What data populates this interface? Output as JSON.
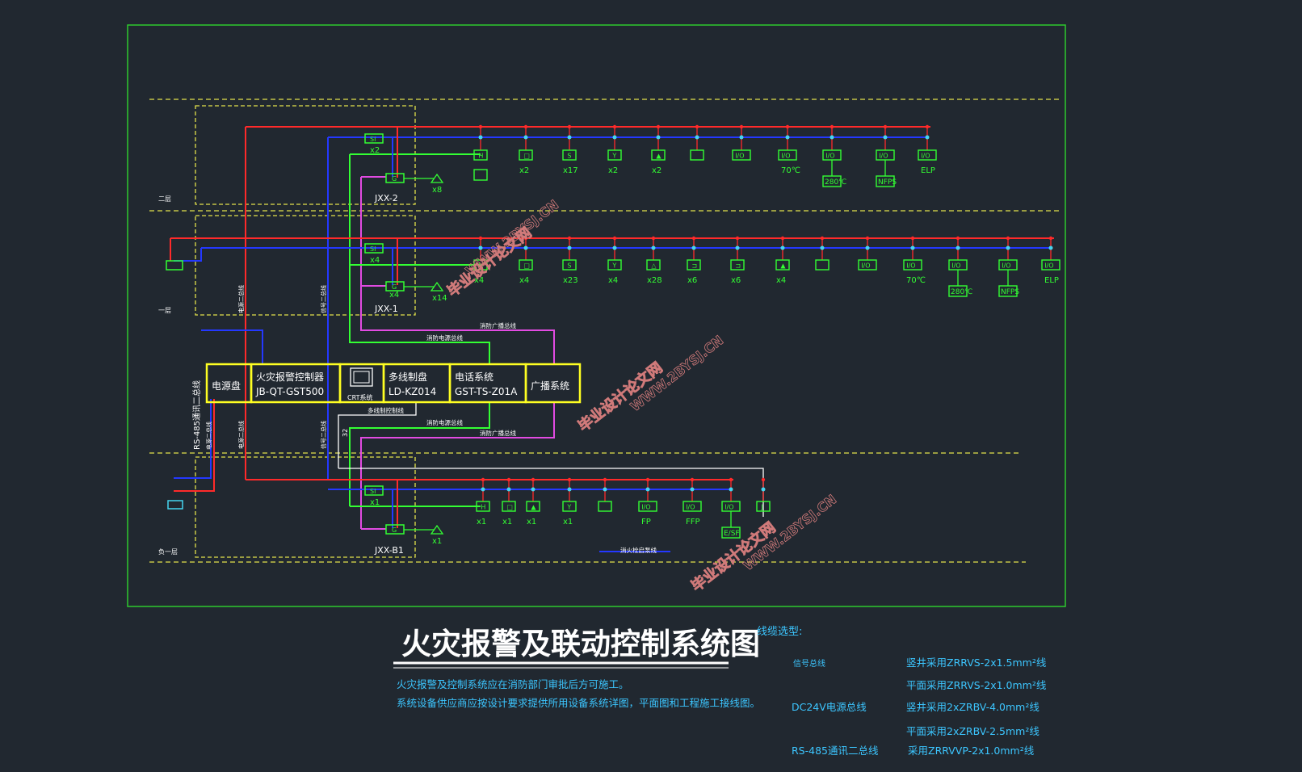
{
  "title": "火灾报警及联动控制系统图",
  "notes": [
    "火灾报警及控制系统应在消防部门审批后方可施工。",
    "系统设备供应商应按设计要求提供所用设备系统详图，平面图和工程施工接线图。"
  ],
  "cable": {
    "heading": "线缆选型:",
    "rows": [
      {
        "label": "信号总线",
        "value": "竖井采用ZRRVS-2x1.5mm²线"
      },
      {
        "label": "",
        "value": "平面采用ZRRVS-2x1.0mm²线"
      },
      {
        "label": "DC24V电源总线",
        "value": "竖井采用2xZRBV-4.0mm²线"
      },
      {
        "label": "",
        "value": "平面采用2xZRBV-2.5mm²线"
      },
      {
        "label": "RS-485通讯二总线",
        "value": "采用ZRRVVP-2x1.0mm²线"
      }
    ]
  },
  "floors": [
    "二层",
    "一层",
    "负一层"
  ],
  "boxes": [
    "JXX-2",
    "JXX-1",
    "JXX-B1"
  ],
  "control": [
    {
      "name": "电源盘",
      "sub": ""
    },
    {
      "name": "火灾报警控制器",
      "sub": "JB-QT-GST500"
    },
    {
      "name": "CRT系统",
      "sub": ""
    },
    {
      "name": "多线制盘",
      "sub": "LD-KZ014"
    },
    {
      "name": "电话系统",
      "sub": "GST-TS-Z01A"
    },
    {
      "name": "广播系统",
      "sub": ""
    }
  ],
  "line_labels": {
    "power": "消防电源总线",
    "broadcast": "消防广播总线",
    "multi": "多线制控制线",
    "rs485": "RS-485通讯二总线",
    "power_riser": "电源二总线",
    "signal_riser": "信号二总线",
    "fire_pump": "消火栓启泵线",
    "wire_count": "32"
  },
  "row2": {
    "si": "SI",
    "si_count": "x2",
    "g": "G",
    "g_count": "x8",
    "devices": [
      {
        "sym": "H",
        "count": ""
      },
      {
        "sym": "□",
        "count": "x2"
      },
      {
        "sym": "S",
        "count": "x17"
      },
      {
        "sym": "Y",
        "count": "x2"
      },
      {
        "sym": "▲",
        "count": "x2"
      },
      {
        "sym": "",
        "count": ""
      },
      {
        "sym": "I/O",
        "count": ""
      },
      {
        "sym": "I/O",
        "count": "70℃"
      },
      {
        "sym": "I/O",
        "count": "280℃"
      },
      {
        "sym": "I/O",
        "count": "NFPS"
      },
      {
        "sym": "I/O",
        "count": "ELP"
      }
    ]
  },
  "row1": {
    "si": "SI",
    "si_count": "x4",
    "g": "G",
    "g_count": "x14",
    "g_sub": "x4",
    "devices": [
      {
        "sym": "H",
        "count": "x4"
      },
      {
        "sym": "□",
        "count": "x4"
      },
      {
        "sym": "S",
        "count": "x23"
      },
      {
        "sym": "Y",
        "count": "x4"
      },
      {
        "sym": "△",
        "count": "x28"
      },
      {
        "sym": "⊐",
        "count": "x6"
      },
      {
        "sym": "⊐",
        "count": "x6"
      },
      {
        "sym": "▲",
        "count": "x4"
      },
      {
        "sym": "",
        "count": ""
      },
      {
        "sym": "I/O",
        "count": ""
      },
      {
        "sym": "I/O",
        "count": "70℃"
      },
      {
        "sym": "I/O",
        "count": "280℃"
      },
      {
        "sym": "I/O",
        "count": "NFPS"
      },
      {
        "sym": "I/O",
        "count": "ELP"
      }
    ]
  },
  "rowB1": {
    "si": "SI",
    "si_count": "x1",
    "g": "G",
    "g_count": "x1",
    "devices": [
      {
        "sym": "H",
        "count": "x1"
      },
      {
        "sym": "□",
        "count": "x1"
      },
      {
        "sym": "▲",
        "count": "x1"
      },
      {
        "sym": "Y",
        "count": "x1"
      },
      {
        "sym": "",
        "count": ""
      },
      {
        "sym": "I/O",
        "count": "FP"
      },
      {
        "sym": "I/O",
        "count": "FFP"
      },
      {
        "sym": "I/O",
        "count": "E/SF"
      },
      {
        "sym": "J",
        "count": ""
      }
    ]
  },
  "watermark": [
    "毕业设计论文网",
    "WWW.2BYSJ.CN"
  ],
  "colors": {
    "bg": "#212830",
    "frame": "#2ec92e",
    "floor": "#e2e24b",
    "red": "#ff2a2a",
    "blue": "#2438ff",
    "magenta": "#e24be2",
    "green": "#33ff33",
    "cyan": "#45d6f0",
    "yellow": "#ffff22",
    "white": "#ffffff",
    "title": "#ffffff",
    "note": "#3cc6ff"
  }
}
